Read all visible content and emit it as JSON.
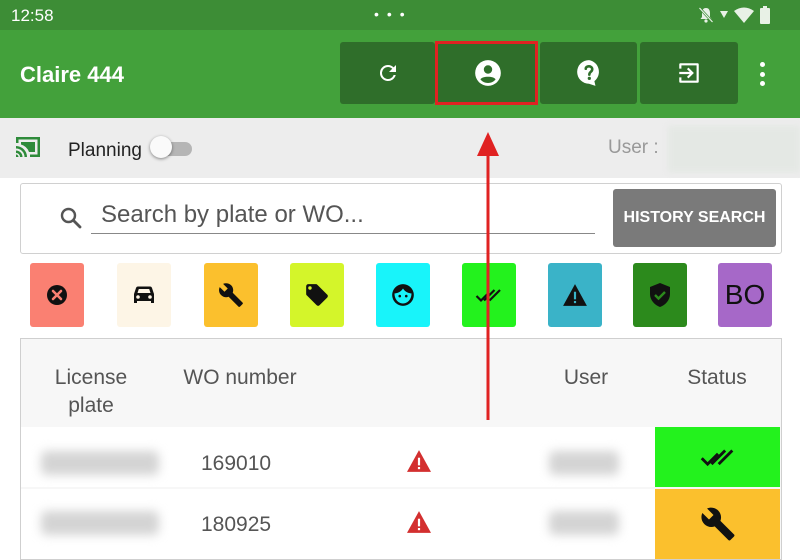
{
  "status_bar": {
    "time": "12:58",
    "dots": "•••",
    "icons": [
      "bell-off-icon",
      "wifi-icon",
      "battery-icon"
    ]
  },
  "app_bar": {
    "title": "Claire 444",
    "buttons": [
      {
        "name": "refresh",
        "icon": "refresh-icon"
      },
      {
        "name": "account",
        "icon": "account-icon",
        "highlighted": true
      },
      {
        "name": "help",
        "icon": "help-icon"
      },
      {
        "name": "logout",
        "icon": "logout-icon"
      }
    ],
    "overflow_icon": "more-vert-icon"
  },
  "planning": {
    "label": "Planning",
    "toggle_on": false,
    "user_label": "User :"
  },
  "search": {
    "placeholder": "Search by plate or WO...",
    "history_button": "HISTORY SEARCH"
  },
  "filters": [
    {
      "name": "cancelled",
      "color": "#fa8072",
      "icon": "cancel-icon"
    },
    {
      "name": "vehicle",
      "color": "#fdf5e6",
      "icon": "car-icon"
    },
    {
      "name": "repair",
      "color": "#fbc02d",
      "icon": "wrench-icon"
    },
    {
      "name": "tag",
      "color": "#d4f52a",
      "icon": "tag-icon"
    },
    {
      "name": "customer",
      "color": "#18f4fa",
      "icon": "face-icon"
    },
    {
      "name": "done",
      "color": "#23f21d",
      "icon": "double-check-icon"
    },
    {
      "name": "warning",
      "color": "#3ab3c8",
      "icon": "warning-icon"
    },
    {
      "name": "verified",
      "color": "#2c8a1c",
      "icon": "shield-check-icon"
    },
    {
      "name": "bo",
      "color": "#a668c8",
      "label": "BO"
    }
  ],
  "table": {
    "headers": {
      "plate": "License plate",
      "wo": "WO number",
      "user": "User",
      "status": "Status"
    },
    "rows": [
      {
        "wo": "169010",
        "warning": true,
        "status_icon": "double-check-icon",
        "status_color": "#23f21d"
      },
      {
        "wo": "180925",
        "warning": true,
        "status_icon": "wrench-icon",
        "status_color": "#fbc02d"
      }
    ]
  },
  "colors": {
    "status_bar": "#3d8d36",
    "app_bar": "#43a13b",
    "toolbar_button": "#2f6e2a",
    "highlight": "#e02222",
    "warning_red": "#d32f2f"
  }
}
